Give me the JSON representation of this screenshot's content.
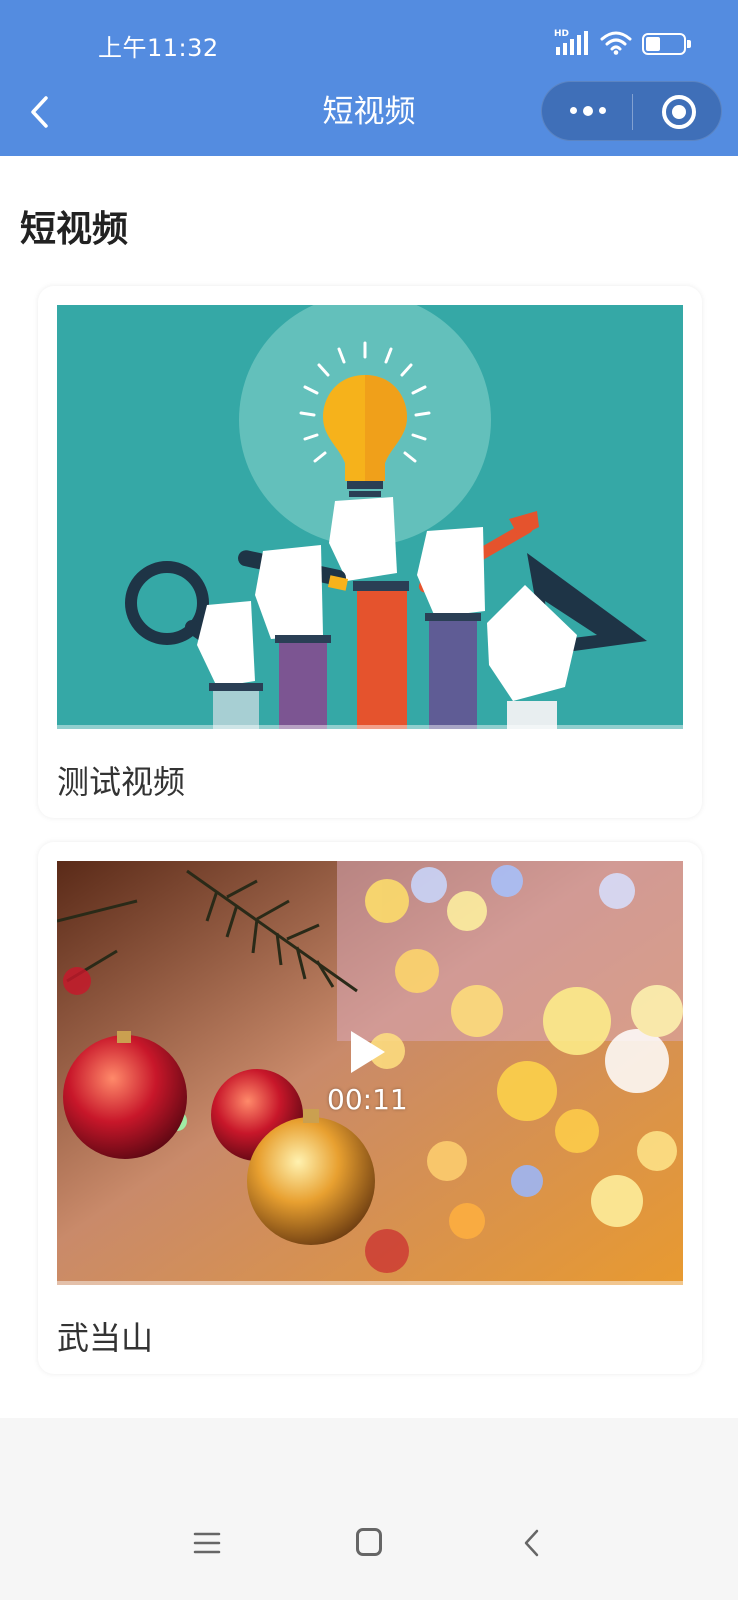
{
  "status_bar": {
    "time": "上午11:32",
    "network_label": "HD",
    "battery_level": "7",
    "icons": [
      "signal-icon",
      "wifi-icon",
      "battery-icon"
    ]
  },
  "nav": {
    "title": "短视频",
    "back_icon": "chevron-left-icon",
    "more_icon": "more-dots-icon",
    "close_icon": "target-circle-icon"
  },
  "page": {
    "section_title": "短视频"
  },
  "videos": [
    {
      "title": "测试视频",
      "thumbnail": "illustration of hands holding lightbulb, magnifier, pen, brush and triangle ruler on teal background"
    },
    {
      "title": "武当山",
      "thumbnail": "christmas tree baubles with bokeh lights",
      "duration": "00:11",
      "play_icon": "play-icon"
    }
  ],
  "colors": {
    "header": "#548ce0",
    "capsule": "#3f6fb8",
    "page_bg": "#ffffff",
    "footer_bg": "#f6f6f6",
    "teal": "#35a8a6"
  },
  "system_nav": {
    "icons": [
      "menu-icon",
      "home-icon",
      "back-icon"
    ]
  }
}
